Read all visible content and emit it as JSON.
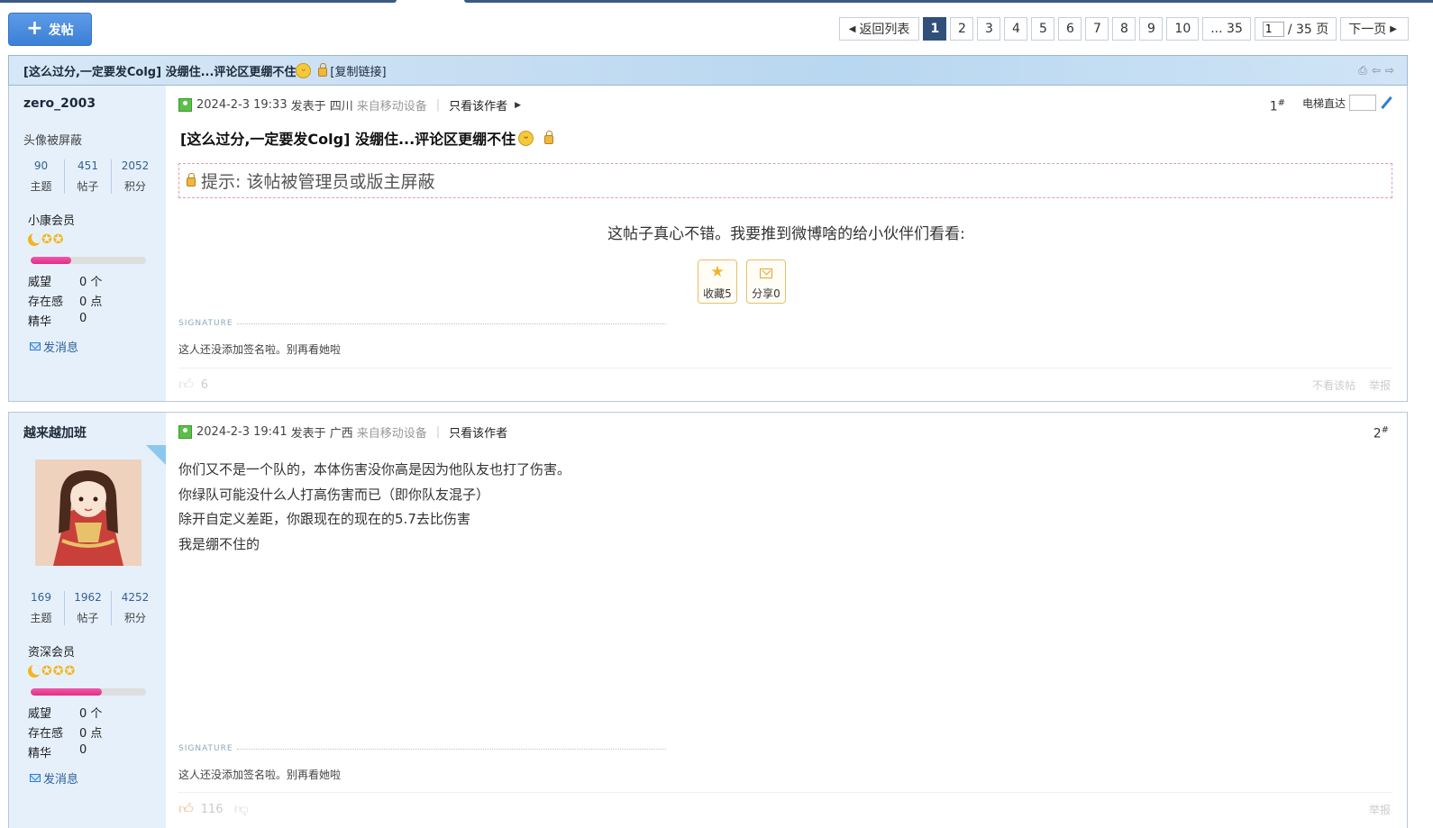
{
  "toolbar": {
    "post_label": "发帖"
  },
  "pager": {
    "back_label": "返回列表",
    "pages": [
      "1",
      "2",
      "3",
      "4",
      "5",
      "6",
      "7",
      "8",
      "9",
      "10"
    ],
    "current": "1",
    "last": "... 35",
    "input_value": "1",
    "total_label": "/ 35 页",
    "next_label": "下一页"
  },
  "thread": {
    "title": "[这么过分,一定要发Colg] 没绷住...评论区更绷不住",
    "copy_label": "[复制链接]"
  },
  "posts": [
    {
      "author": "zero_2003",
      "avatar_note": "头像被屏蔽",
      "stats": [
        {
          "value": "90",
          "label": "主题"
        },
        {
          "value": "451",
          "label": "帖子"
        },
        {
          "value": "2052",
          "label": "积分"
        }
      ],
      "group": "小康会员",
      "stars": 2,
      "level_progress": 0.35,
      "fields": [
        {
          "k": "威望",
          "v": "0 个"
        },
        {
          "k": "存在感",
          "v": "0 点"
        },
        {
          "k": "精华",
          "v": "0"
        }
      ],
      "message_label": "发消息",
      "date": "2024-2-3 19:33",
      "posted_in": "发表于 四川",
      "device": "来自移动设备",
      "only_author": "只看该作者",
      "floor": "1",
      "elevator_label": "电梯直达",
      "title": "[这么过分,一定要发Colg] 没绷住...评论区更绷不住",
      "notice": "提示: 该帖被管理员或版主屏蔽",
      "share_text": "这帖子真心不错。我要推到微博啥的给小伙伴们看看:",
      "fav_label": "收藏5",
      "share_label": "分享0",
      "signature_label": "SIGNATURE",
      "signature": "这人还没添加签名啦。别再看她啦",
      "likes": "6",
      "hide_label": "不看该帖",
      "report_label": "举报"
    },
    {
      "author": "越来越加班",
      "stats": [
        {
          "value": "169",
          "label": "主题"
        },
        {
          "value": "1962",
          "label": "帖子"
        },
        {
          "value": "4252",
          "label": "积分"
        }
      ],
      "group": "资深会员",
      "stars": 3,
      "level_progress": 0.62,
      "fields": [
        {
          "k": "威望",
          "v": "0 个"
        },
        {
          "k": "存在感",
          "v": "0 点"
        },
        {
          "k": "精华",
          "v": "0"
        }
      ],
      "message_label": "发消息",
      "date": "2024-2-3 19:41",
      "posted_in": "发表于 广西",
      "device": "来自移动设备",
      "only_author": "只看该作者",
      "floor": "2",
      "body": [
        "你们又不是一个队的，本体伤害没你高是因为他队友也打了伤害。",
        "你绿队可能没什么人打高伤害而已（即你队友混子）",
        "除开自定义差距，你跟现在的现在的5.7去比伤害",
        "我是绷不住的"
      ],
      "signature_label": "SIGNATURE",
      "signature": "这人还没添加签名啦。别再看她啦",
      "likes": "116",
      "report_label": "举报"
    }
  ],
  "colors": {
    "accent": "#30507a",
    "post_button": "#3c7fd7",
    "sidebar": "#e5f0fb",
    "progress": "#e02d86"
  },
  "icons": [
    "plus-icon",
    "caret-left-icon",
    "caret-right-icon",
    "lock-icon",
    "grin-emoji",
    "print-icon",
    "prev-thread-icon",
    "next-thread-icon",
    "user-icon",
    "star-icon",
    "mail-icon",
    "envelope-icon",
    "thumb-up-icon",
    "thumb-down-icon",
    "pen-icon"
  ]
}
